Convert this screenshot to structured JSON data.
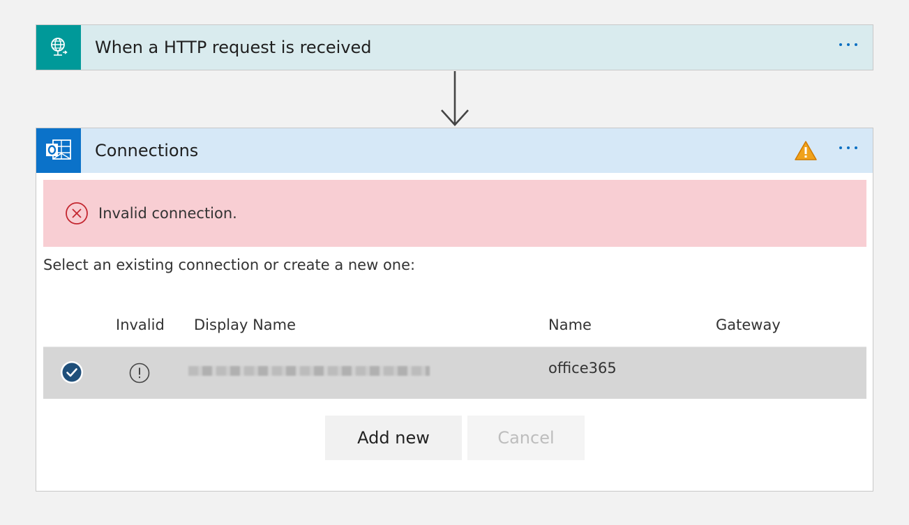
{
  "trigger": {
    "title": "When a HTTP request is received",
    "icon": "globe-request-icon",
    "tile_color": "#009999",
    "header_bg": "#d9ebee"
  },
  "connections_step": {
    "title": "Connections",
    "icon": "outlook-icon",
    "warning_icon": "warning-icon",
    "tile_color": "#0b72c9",
    "header_bg": "#d6e8f7",
    "error": {
      "text": "Invalid connection.",
      "icon": "error-circle-icon",
      "bg": "#f8ced3"
    },
    "prompt": "Select an existing connection or create a new one:",
    "table": {
      "headers": {
        "invalid": "Invalid",
        "display_name": "Display Name",
        "name": "Name",
        "gateway": "Gateway"
      },
      "rows": [
        {
          "selected": true,
          "invalid_icon": "exclamation-circle-icon",
          "display_name_redacted": true,
          "name": "office365",
          "gateway": ""
        }
      ]
    },
    "buttons": {
      "add_new": "Add new",
      "cancel": "Cancel"
    }
  }
}
